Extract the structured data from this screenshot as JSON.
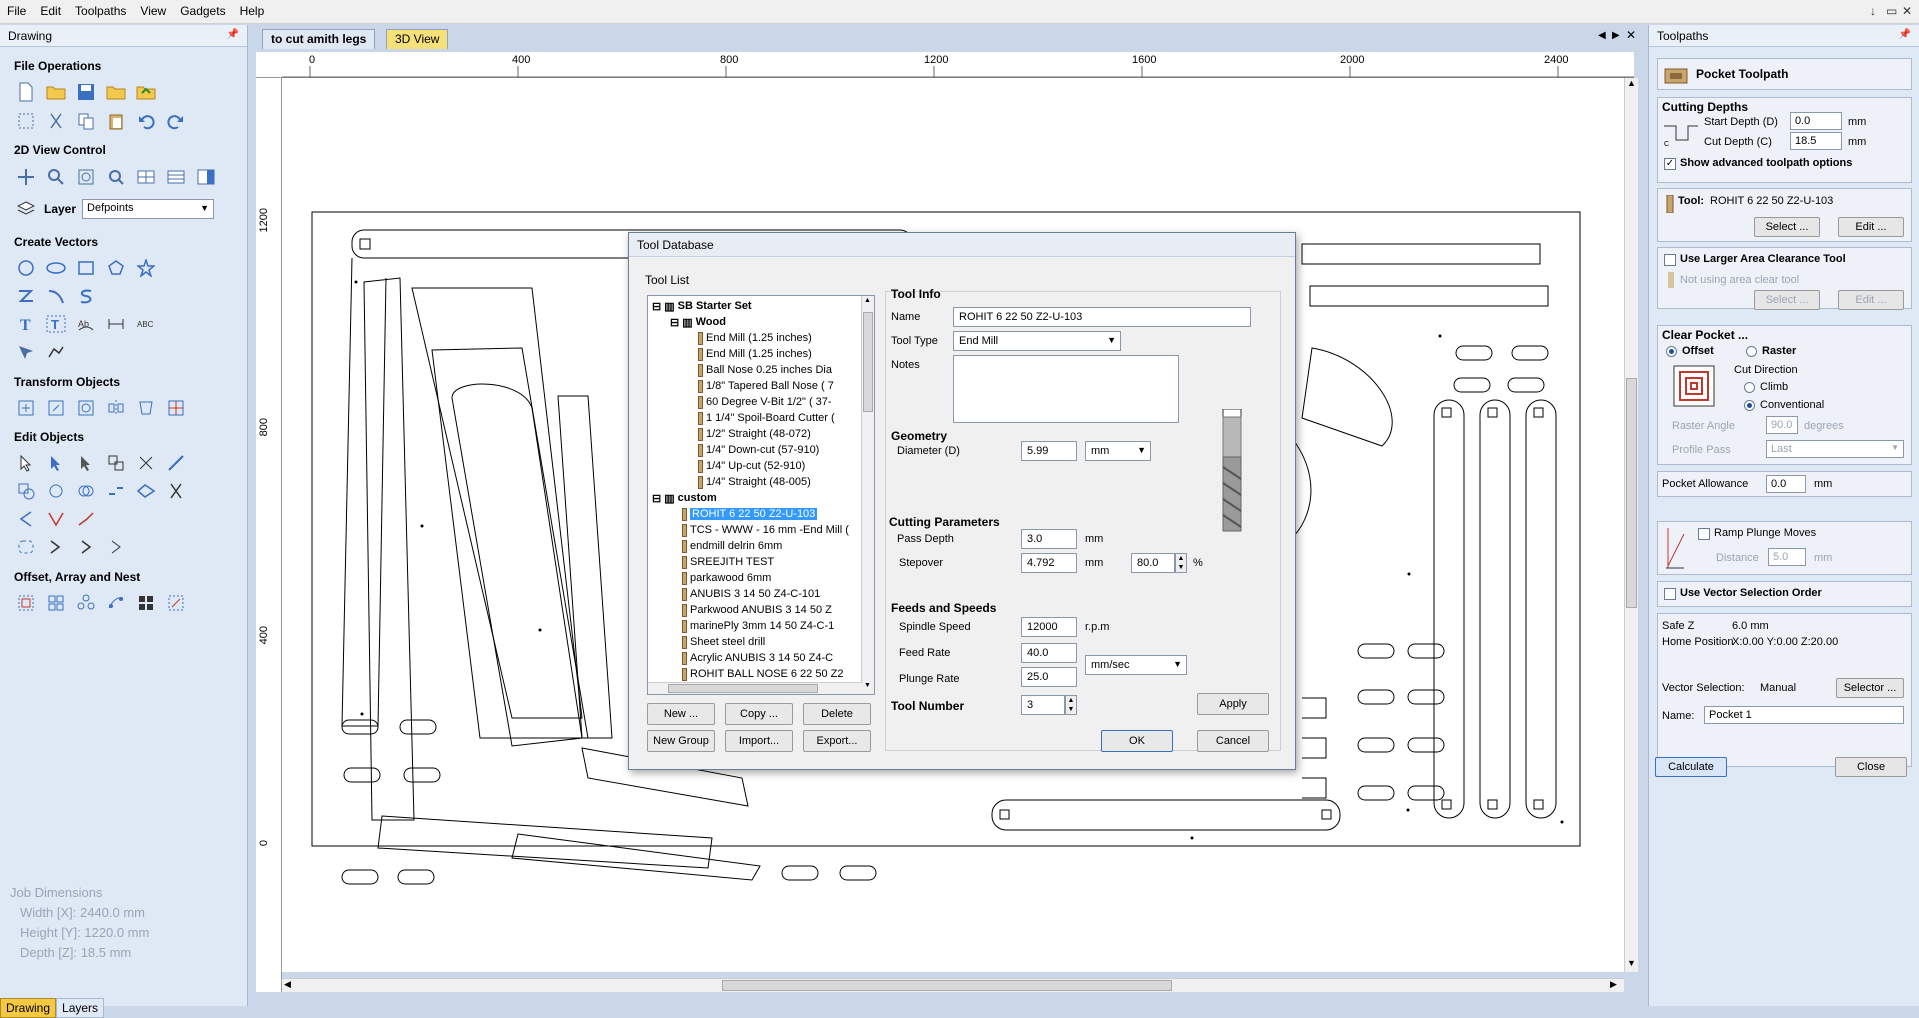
{
  "menu": [
    "File",
    "Edit",
    "Toolpaths",
    "View",
    "Gadgets",
    "Help"
  ],
  "window_controls": [
    "↓",
    "▭",
    "✕"
  ],
  "left_panel": {
    "title": "Drawing",
    "sections": {
      "file_operations": "File Operations",
      "view_control": "2D View Control",
      "create_vectors": "Create Vectors",
      "transform_objects": "Transform Objects",
      "edit_objects": "Edit Objects",
      "offset_array_nest": "Offset, Array and Nest"
    },
    "layer_label": "Layer",
    "layer_value": "Defpoints",
    "job_dimensions": {
      "title": "Job Dimensions",
      "width": "Width  [X]: 2440.0 mm",
      "height": "Height [Y]: 1220.0 mm",
      "depth": "Depth  [Z]: 18.5 mm"
    },
    "tabs": [
      "Drawing",
      "Layers"
    ]
  },
  "document": {
    "tabs": [
      "to cut amith legs",
      "3D View"
    ],
    "ruler_h": [
      "0",
      "400",
      "800",
      "1200",
      "1600",
      "2000",
      "2400"
    ],
    "ruler_v": [
      "1200",
      "800",
      "400",
      "0"
    ]
  },
  "dialog": {
    "title": "Tool Database",
    "tool_list_label": "Tool List",
    "tree": {
      "group1": "SB Starter Set",
      "subgroup1": "Wood",
      "wood_items": [
        "End Mill (1.25 inches)",
        "End Mill (1.25 inches)",
        "Ball Nose 0.25 inches Dia",
        "1/8\" Tapered Ball Nose ( 7",
        "60 Degree V-Bit 1/2\" ( 37-",
        "1 1/4\" Spoil-Board Cutter (",
        "1/2\" Straight  (48-072)",
        "1/4\"  Down-cut (57-910)",
        "1/4\" Up-cut (52-910)",
        "1/4\" Straight  (48-005)"
      ],
      "group2": "custom",
      "custom_items": [
        "ROHIT 6 22 50   Z2-U-103",
        "TCS - WWW - 16 mm -End Mill (",
        "endmill delrin 6mm",
        "SREEJITH TEST",
        "parkawood 6mm",
        "ANUBIS 3  14 50    Z4-C-101",
        "Parkwood ANUBIS 3  14 50    Z",
        "marinePly 3mm  14 50    Z4-C-1",
        "Sheet steel drill",
        "Acrylic ANUBIS 3  14 50    Z4-C",
        "ROHIT BALL NOSE 6 22 50   Z2"
      ]
    },
    "buttons": {
      "new": "New ...",
      "copy": "Copy ...",
      "delete": "Delete",
      "new_group": "New Group",
      "import": "Import...",
      "export": "Export...",
      "ok": "OK",
      "cancel": "Cancel",
      "apply": "Apply"
    },
    "tool_info": {
      "header": "Tool Info",
      "name_label": "Name",
      "name_value": "ROHIT 6 22 50   Z2-U-103",
      "type_label": "Tool Type",
      "type_value": "End Mill",
      "notes_label": "Notes"
    },
    "geometry": {
      "header": "Geometry",
      "diameter_label": "Diameter (D)",
      "diameter_value": "5.99",
      "units": "mm"
    },
    "cutting": {
      "header": "Cutting Parameters",
      "pass_label": "Pass Depth",
      "pass_value": "3.0",
      "pass_unit": "mm",
      "stepover_label": "Stepover",
      "stepover_value": "4.792",
      "stepover_unit": "mm",
      "stepover_pct": "80.0",
      "pct_sign": "%"
    },
    "feeds": {
      "header": "Feeds and Speeds",
      "spindle_label": "Spindle Speed",
      "spindle_value": "12000",
      "spindle_unit": "r.p.m",
      "feed_label": "Feed Rate",
      "feed_value": "40.0",
      "plunge_label": "Plunge Rate",
      "plunge_value": "25.0",
      "rate_units": "mm/sec"
    },
    "tool_number_label": "Tool Number",
    "tool_number_value": "3"
  },
  "right_panel": {
    "title": "Toolpaths",
    "pocket_title": "Pocket Toolpath",
    "cutting_depths": "Cutting Depths",
    "start_depth_label": "Start Depth (D)",
    "start_depth_value": "0.0",
    "cut_depth_label": "Cut Depth (C)",
    "cut_depth_value": "18.5",
    "mm": "mm",
    "show_advanced": "Show advanced toolpath options",
    "tool_label": "Tool:",
    "tool_value": "ROHIT 6 22 50   Z2-U-103",
    "select_btn": "Select ...",
    "edit_btn": "Edit ...",
    "larger_area": "Use Larger Area Clearance Tool",
    "not_using": "Not using area clear tool",
    "clear_pocket": "Clear Pocket ...",
    "offset": "Offset",
    "raster": "Raster",
    "cut_direction": "Cut Direction",
    "climb": "Climb",
    "conventional": "Conventional",
    "raster_angle_label": "Raster Angle",
    "raster_angle_value": "90.0",
    "degrees": "degrees",
    "profile_pass_label": "Profile Pass",
    "profile_pass_value": "Last",
    "pocket_allowance_label": "Pocket Allowance",
    "pocket_allowance_value": "0.0",
    "ramp_plunge": "Ramp Plunge Moves",
    "distance_label": "Distance",
    "distance_value": "5.0",
    "vector_order": "Use Vector Selection Order",
    "safe_z_label": "Safe Z",
    "safe_z_value": "6.0 mm",
    "home_label": "Home Position",
    "home_value": "X:0.00 Y:0.00 Z:20.00",
    "vector_sel_label": "Vector Selection:",
    "vector_sel_value": "Manual",
    "selector_btn": "Selector ...",
    "name_label": "Name:",
    "name_value": "Pocket 1",
    "calculate": "Calculate",
    "close": "Close"
  },
  "colors": {
    "panel_bg": "#dfe8f5",
    "selection": "#3399ff",
    "active_tab": "#f5c842"
  }
}
